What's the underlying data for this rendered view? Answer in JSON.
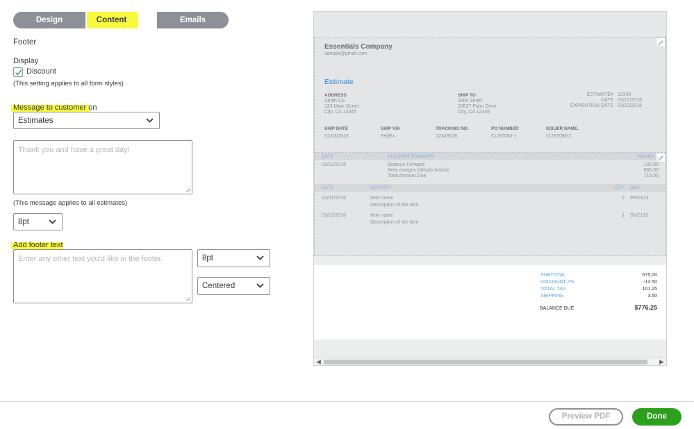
{
  "tabs": [
    {
      "label": "Design"
    },
    {
      "label": "Content"
    },
    {
      "label": "Emails"
    }
  ],
  "left": {
    "section_title": "Footer",
    "display_label": "Display",
    "discount_label": "Discount",
    "discount_checked": true,
    "discount_note": "(This setting applies to all form styles)",
    "message_label": "Message to customer on",
    "message_select": "Estimates",
    "message_placeholder": "Thank you and have a great day!",
    "message_note": "(This message applies to all estimates)",
    "message_size": "8pt",
    "footer_label": "Add footer text",
    "footer_placeholder": "Enter any other text you'd like in the footer.",
    "footer_size": "8pt",
    "footer_align": "Centered"
  },
  "preview": {
    "company": "Essentials Company",
    "email": "sample@gmail.com",
    "doc_title": "Estimate",
    "address_label": "ADDRESS",
    "address_lines": [
      "Smith Co.",
      "123 Main Street",
      "City, CA 12345"
    ],
    "shipto_label": "SHIP TO",
    "shipto_lines": [
      "John Smith",
      "20637 Palm Drive",
      "City, CA 12345"
    ],
    "meta": [
      {
        "label": "ESTIMATE#",
        "value": "12345"
      },
      {
        "label": "DATE",
        "value": "01/12/2016"
      },
      {
        "label": "EXPIRATION DATE",
        "value": "02/12/2016"
      }
    ],
    "ship_headers": [
      "SHIP DATE",
      "SHIP VIA",
      "TRACKING NO.",
      "PO NUMBER",
      "ISSUER NAME."
    ],
    "ship_values": [
      "01/03/2015",
      "FedEx",
      "12345678",
      "CUSTOM-1",
      "CUSTOM-2"
    ],
    "summary_headers": [
      "DATE",
      "ACCOUNT SUMMARY",
      "AMOUN"
    ],
    "summary_date": "01/12/2016",
    "summary_rows": [
      {
        "label": "Balance Forward",
        "value": "100.00"
      },
      {
        "label": "New charges (details below)",
        "value": "665.00"
      },
      {
        "label": "Total Amount Due",
        "value": "715.00"
      }
    ],
    "activity_headers": [
      "DATE",
      "ACTIVITY",
      "QTY",
      "SKU"
    ],
    "activity_rows": [
      {
        "date": "12/01/2016",
        "name": "Item name",
        "desc": "Description of the item",
        "qty": "2",
        "sku": "PRD123"
      },
      {
        "date": "01/12/2016",
        "name": "Item name",
        "desc": "Description of the item",
        "qty": "1",
        "sku": "SVC123"
      }
    ],
    "totals": [
      {
        "label": "SUBTOTAL",
        "value": "675.00"
      },
      {
        "label": "DISCOUNT 2%",
        "value": "-13.50"
      },
      {
        "label": "TOTAL TAX",
        "value": "101.25"
      },
      {
        "label": "SHIPPING",
        "value": "3.50"
      }
    ],
    "balance_label": "BALANCE DUE",
    "balance_value": "$776.25"
  },
  "buttons": {
    "preview_pdf": "Preview PDF",
    "done": "Done"
  },
  "colors": {
    "highlight": "#f6f93d",
    "tab_bg": "#8d9096",
    "done_green": "#2ca01c",
    "preview_blue": "#5c9fd6"
  }
}
